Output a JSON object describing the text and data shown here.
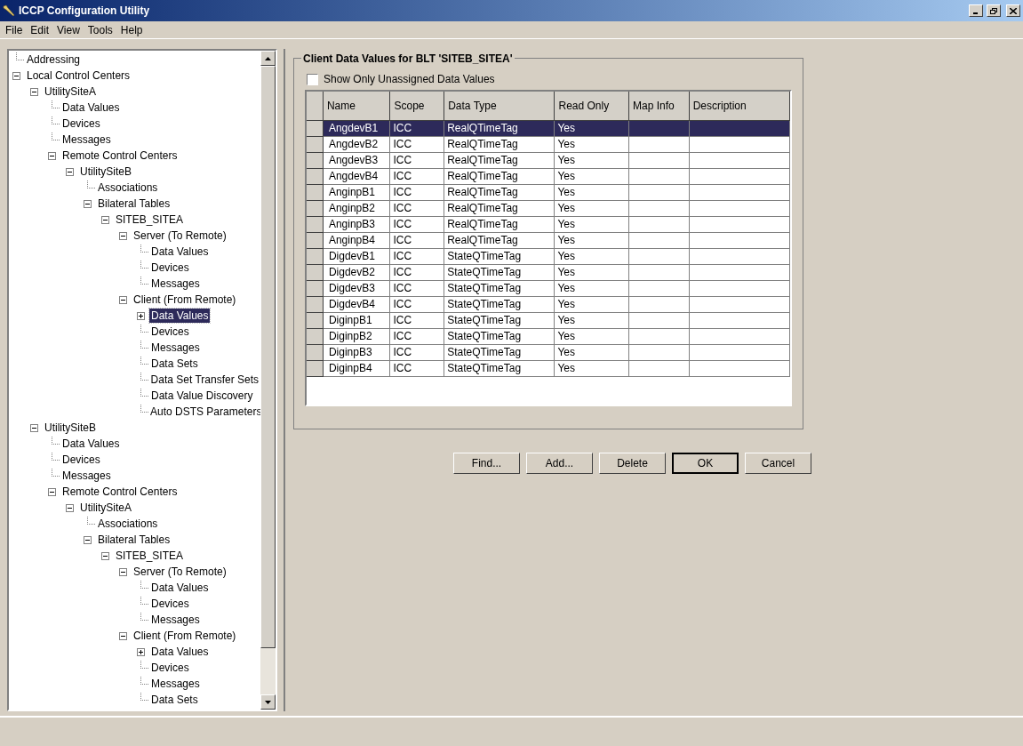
{
  "window": {
    "title": "ICCP Configuration Utility"
  },
  "menu": [
    {
      "label": "File"
    },
    {
      "label": "Edit"
    },
    {
      "label": "View"
    },
    {
      "label": "Tools"
    },
    {
      "label": "Help"
    }
  ],
  "tree": [
    {
      "label": "Addressing",
      "selected": false
    },
    {
      "label": "Local Control Centers",
      "expanded": true,
      "selected": false,
      "children": [
        {
          "label": "UtilitySiteA",
          "expanded": true,
          "selected": false,
          "children": [
            {
              "label": "Data Values",
              "selected": false
            },
            {
              "label": "Devices",
              "selected": false
            },
            {
              "label": "Messages",
              "selected": false
            },
            {
              "label": "Remote Control Centers",
              "expanded": true,
              "selected": false,
              "children": [
                {
                  "label": "UtilitySiteB",
                  "expanded": true,
                  "selected": false,
                  "children": [
                    {
                      "label": "Associations",
                      "selected": false
                    },
                    {
                      "label": "Bilateral Tables",
                      "expanded": true,
                      "selected": false,
                      "children": [
                        {
                          "label": "SITEB_SITEA",
                          "expanded": true,
                          "selected": false,
                          "children": [
                            {
                              "label": "Server (To Remote)",
                              "expanded": true,
                              "selected": false,
                              "children": [
                                {
                                  "label": "Data Values",
                                  "selected": false
                                },
                                {
                                  "label": "Devices",
                                  "selected": false
                                },
                                {
                                  "label": "Messages",
                                  "selected": false
                                }
                              ]
                            },
                            {
                              "label": "Client (From Remote)",
                              "expanded": true,
                              "selected": false,
                              "children": [
                                {
                                  "label": "Data Values",
                                  "expanded": false,
                                  "selected": true
                                },
                                {
                                  "label": "Devices",
                                  "selected": false
                                },
                                {
                                  "label": "Messages",
                                  "selected": false
                                },
                                {
                                  "label": "Data Sets",
                                  "selected": false
                                },
                                {
                                  "label": "Data Set Transfer Sets",
                                  "selected": false
                                },
                                {
                                  "label": "Data Value Discovery",
                                  "selected": false
                                },
                                {
                                  "label": "Auto DSTS Parameters",
                                  "selected": false
                                }
                              ]
                            }
                          ]
                        }
                      ]
                    }
                  ]
                }
              ]
            }
          ]
        },
        {
          "label": "UtilitySiteB",
          "expanded": true,
          "selected": false,
          "children": [
            {
              "label": "Data Values",
              "selected": false
            },
            {
              "label": "Devices",
              "selected": false
            },
            {
              "label": "Messages",
              "selected": false
            },
            {
              "label": "Remote Control Centers",
              "expanded": true,
              "selected": false,
              "children": [
                {
                  "label": "UtilitySiteA",
                  "expanded": true,
                  "selected": false,
                  "children": [
                    {
                      "label": "Associations",
                      "selected": false
                    },
                    {
                      "label": "Bilateral Tables",
                      "expanded": true,
                      "selected": false,
                      "children": [
                        {
                          "label": "SITEB_SITEA",
                          "expanded": true,
                          "selected": false,
                          "children": [
                            {
                              "label": "Server (To Remote)",
                              "expanded": true,
                              "selected": false,
                              "children": [
                                {
                                  "label": "Data Values",
                                  "selected": false
                                },
                                {
                                  "label": "Devices",
                                  "selected": false
                                },
                                {
                                  "label": "Messages",
                                  "selected": false
                                }
                              ]
                            },
                            {
                              "label": "Client (From Remote)",
                              "expanded": true,
                              "selected": false,
                              "children": [
                                {
                                  "label": "Data Values",
                                  "expanded": false,
                                  "selected": false
                                },
                                {
                                  "label": "Devices",
                                  "selected": false
                                },
                                {
                                  "label": "Messages",
                                  "selected": false
                                },
                                {
                                  "label": "Data Sets",
                                  "selected": false
                                }
                              ]
                            }
                          ]
                        }
                      ]
                    }
                  ]
                }
              ]
            }
          ]
        }
      ]
    }
  ],
  "panel": {
    "title": "Client Data Values for BLT 'SITEB_SITEA'",
    "checkbox": {
      "label": "Show Only Unassigned Data Values",
      "checked": false
    },
    "table": {
      "columns": [
        "Name",
        "Scope",
        "Data Type",
        "Read Only",
        "Map Info",
        "Description"
      ],
      "rows": [
        {
          "cells": [
            "AngdevB1",
            "ICC",
            "RealQTimeTag",
            "Yes"
          ],
          "selected": true
        },
        {
          "cells": [
            "AngdevB2",
            "ICC",
            "RealQTimeTag",
            "Yes"
          ],
          "selected": false
        },
        {
          "cells": [
            "AngdevB3",
            "ICC",
            "RealQTimeTag",
            "Yes"
          ],
          "selected": false
        },
        {
          "cells": [
            "AngdevB4",
            "ICC",
            "RealQTimeTag",
            "Yes"
          ],
          "selected": false
        },
        {
          "cells": [
            "AnginpB1",
            "ICC",
            "RealQTimeTag",
            "Yes"
          ],
          "selected": false
        },
        {
          "cells": [
            "AnginpB2",
            "ICC",
            "RealQTimeTag",
            "Yes"
          ],
          "selected": false
        },
        {
          "cells": [
            "AnginpB3",
            "ICC",
            "RealQTimeTag",
            "Yes"
          ],
          "selected": false
        },
        {
          "cells": [
            "AnginpB4",
            "ICC",
            "RealQTimeTag",
            "Yes"
          ],
          "selected": false
        },
        {
          "cells": [
            "DigdevB1",
            "ICC",
            "StateQTimeTag",
            "Yes"
          ],
          "selected": false
        },
        {
          "cells": [
            "DigdevB2",
            "ICC",
            "StateQTimeTag",
            "Yes"
          ],
          "selected": false
        },
        {
          "cells": [
            "DigdevB3",
            "ICC",
            "StateQTimeTag",
            "Yes"
          ],
          "selected": false
        },
        {
          "cells": [
            "DigdevB4",
            "ICC",
            "StateQTimeTag",
            "Yes"
          ],
          "selected": false
        },
        {
          "cells": [
            "DiginpB1",
            "ICC",
            "StateQTimeTag",
            "Yes"
          ],
          "selected": false
        },
        {
          "cells": [
            "DiginpB2",
            "ICC",
            "StateQTimeTag",
            "Yes"
          ],
          "selected": false
        },
        {
          "cells": [
            "DiginpB3",
            "ICC",
            "StateQTimeTag",
            "Yes"
          ],
          "selected": false
        },
        {
          "cells": [
            "DiginpB4",
            "ICC",
            "StateQTimeTag",
            "Yes"
          ],
          "selected": false
        }
      ]
    }
  },
  "buttons": [
    {
      "label": "Find...",
      "default": false
    },
    {
      "label": "Add...",
      "default": false
    },
    {
      "label": "Delete",
      "default": false
    },
    {
      "label": "OK",
      "default": true
    },
    {
      "label": "Cancel",
      "default": false
    }
  ]
}
